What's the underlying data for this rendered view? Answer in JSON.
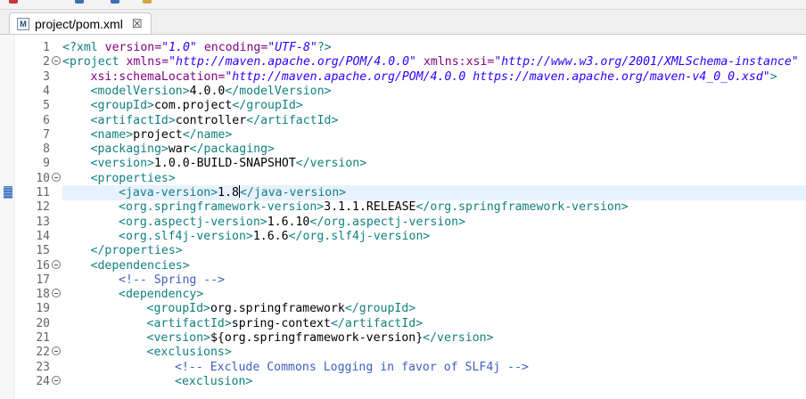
{
  "tab": {
    "icon_text": "M",
    "title": "project/pom.xml",
    "close": "☒"
  },
  "editor": {
    "current_line": 11,
    "lines": [
      {
        "n": "1",
        "fold": false,
        "indent": 0,
        "tokens": [
          [
            "t",
            "<?xml "
          ],
          [
            "a",
            "version="
          ],
          [
            "v",
            "\"1.0\""
          ],
          [
            "a",
            " encoding="
          ],
          [
            "v",
            "\"UTF-8\""
          ],
          [
            "t",
            "?>"
          ]
        ]
      },
      {
        "n": "2",
        "fold": true,
        "indent": 0,
        "tokens": [
          [
            "t",
            "<project "
          ],
          [
            "a",
            "xmlns="
          ],
          [
            "v",
            "\"http://maven.apache.org/POM/4.0.0\""
          ],
          [
            "a",
            " xmlns:xsi="
          ],
          [
            "v",
            "\"http://www.w3.org/2001/XMLSchema-instance\""
          ]
        ]
      },
      {
        "n": "3",
        "fold": false,
        "indent": 1,
        "tokens": [
          [
            "a",
            "xsi:schemaLocation="
          ],
          [
            "v",
            "\"http://maven.apache.org/POM/4.0.0 https://maven.apache.org/maven-v4_0_0.xsd\""
          ],
          [
            "t",
            ">"
          ]
        ]
      },
      {
        "n": "4",
        "fold": false,
        "indent": 1,
        "tokens": [
          [
            "t",
            "<modelVersion>"
          ],
          [
            "x",
            "4.0.0"
          ],
          [
            "t",
            "</modelVersion>"
          ]
        ]
      },
      {
        "n": "5",
        "fold": false,
        "indent": 1,
        "tokens": [
          [
            "t",
            "<groupId>"
          ],
          [
            "x",
            "com.project"
          ],
          [
            "t",
            "</groupId>"
          ]
        ]
      },
      {
        "n": "6",
        "fold": false,
        "indent": 1,
        "tokens": [
          [
            "t",
            "<artifactId>"
          ],
          [
            "x",
            "controller"
          ],
          [
            "t",
            "</artifactId>"
          ]
        ]
      },
      {
        "n": "7",
        "fold": false,
        "indent": 1,
        "tokens": [
          [
            "t",
            "<name>"
          ],
          [
            "x",
            "project"
          ],
          [
            "t",
            "</name>"
          ]
        ]
      },
      {
        "n": "8",
        "fold": false,
        "indent": 1,
        "tokens": [
          [
            "t",
            "<packaging>"
          ],
          [
            "x",
            "war"
          ],
          [
            "t",
            "</packaging>"
          ]
        ]
      },
      {
        "n": "9",
        "fold": false,
        "indent": 1,
        "tokens": [
          [
            "t",
            "<version>"
          ],
          [
            "x",
            "1.0.0-BUILD-SNAPSHOT"
          ],
          [
            "t",
            "</version>"
          ]
        ]
      },
      {
        "n": "10",
        "fold": true,
        "indent": 1,
        "tokens": [
          [
            "t",
            "<properties>"
          ]
        ]
      },
      {
        "n": "11",
        "fold": false,
        "indent": 2,
        "tokens": [
          [
            "t",
            "<java-version>"
          ],
          [
            "x",
            "1.8"
          ],
          [
            "c",
            ""
          ],
          [
            "t",
            "</java-version>"
          ]
        ]
      },
      {
        "n": "12",
        "fold": false,
        "indent": 2,
        "tokens": [
          [
            "t",
            "<org.springframework-version>"
          ],
          [
            "x",
            "3.1.1.RELEASE"
          ],
          [
            "t",
            "</org.springframework-version>"
          ]
        ]
      },
      {
        "n": "13",
        "fold": false,
        "indent": 2,
        "tokens": [
          [
            "t",
            "<org.aspectj-version>"
          ],
          [
            "x",
            "1.6.10"
          ],
          [
            "t",
            "</org.aspectj-version>"
          ]
        ]
      },
      {
        "n": "14",
        "fold": false,
        "indent": 2,
        "tokens": [
          [
            "t",
            "<org.slf4j-version>"
          ],
          [
            "x",
            "1.6.6"
          ],
          [
            "t",
            "</org.slf4j-version>"
          ]
        ]
      },
      {
        "n": "15",
        "fold": false,
        "indent": 1,
        "tokens": [
          [
            "t",
            "</properties>"
          ]
        ]
      },
      {
        "n": "16",
        "fold": true,
        "indent": 1,
        "tokens": [
          [
            "t",
            "<dependencies>"
          ]
        ]
      },
      {
        "n": "17",
        "fold": false,
        "indent": 2,
        "tokens": [
          [
            "m",
            "<!-- Spring -->"
          ]
        ]
      },
      {
        "n": "18",
        "fold": true,
        "indent": 2,
        "tokens": [
          [
            "t",
            "<dependency>"
          ]
        ]
      },
      {
        "n": "19",
        "fold": false,
        "indent": 3,
        "tokens": [
          [
            "t",
            "<groupId>"
          ],
          [
            "x",
            "org.springframework"
          ],
          [
            "t",
            "</groupId>"
          ]
        ]
      },
      {
        "n": "20",
        "fold": false,
        "indent": 3,
        "tokens": [
          [
            "t",
            "<artifactId>"
          ],
          [
            "x",
            "spring-context"
          ],
          [
            "t",
            "</artifactId>"
          ]
        ]
      },
      {
        "n": "21",
        "fold": false,
        "indent": 3,
        "tokens": [
          [
            "t",
            "<version>"
          ],
          [
            "x",
            "${org.springframework-version}"
          ],
          [
            "t",
            "</version>"
          ]
        ]
      },
      {
        "n": "22",
        "fold": true,
        "indent": 3,
        "tokens": [
          [
            "t",
            "<exclusions>"
          ]
        ]
      },
      {
        "n": "23",
        "fold": false,
        "indent": 4,
        "tokens": [
          [
            "m",
            "<!-- Exclude Commons Logging in favor of SLF4j -->"
          ]
        ]
      },
      {
        "n": "24",
        "fold": true,
        "indent": 4,
        "tokens": [
          [
            "t",
            "<exclusion>"
          ]
        ]
      }
    ]
  },
  "colors": {
    "tag": "#117f80",
    "attribute": "#7f007f",
    "value": "#2a00ff",
    "comment": "#3f5fbf",
    "current_line": "#e8f2fe"
  }
}
